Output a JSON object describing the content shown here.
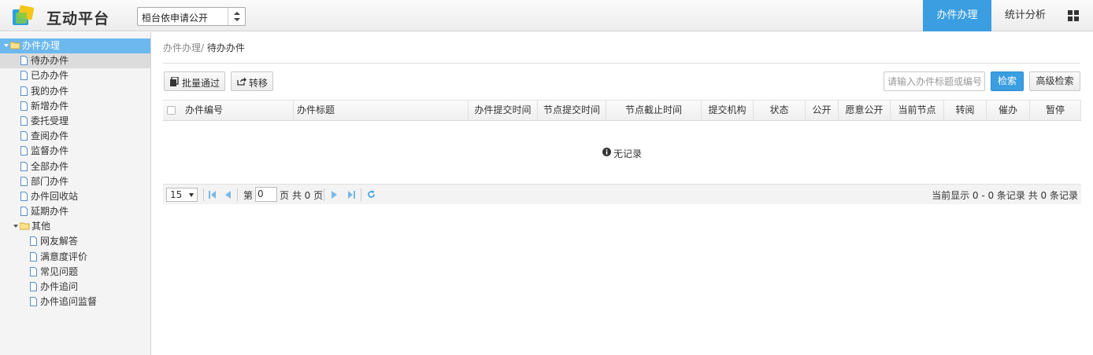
{
  "header": {
    "app_title": "互动平台",
    "platform_select": "桓台依申请公开",
    "tabs": [
      {
        "label": "办件办理",
        "active": true
      },
      {
        "label": "统计分析",
        "active": false
      }
    ],
    "accent_color": "#3a9ee0"
  },
  "sidebar": {
    "root": {
      "label": "办件办理",
      "icon": "folder-open-icon"
    },
    "items": [
      {
        "label": "待办办件",
        "selected": true
      },
      {
        "label": "已办办件"
      },
      {
        "label": "我的办件"
      },
      {
        "label": "新增办件"
      },
      {
        "label": "委托受理"
      },
      {
        "label": "查阅办件"
      },
      {
        "label": "监督办件"
      },
      {
        "label": "全部办件"
      },
      {
        "label": "部门办件"
      },
      {
        "label": "办件回收站"
      },
      {
        "label": "延期办件"
      }
    ],
    "other": {
      "label": "其他",
      "icon": "folder-icon"
    },
    "other_items": [
      {
        "label": "网友解答"
      },
      {
        "label": "满意度评价"
      },
      {
        "label": "常见问题"
      },
      {
        "label": "办件追问"
      },
      {
        "label": "办件追问监督"
      }
    ]
  },
  "breadcrumb": {
    "parent": "办件办理/ ",
    "current": "待办办件"
  },
  "toolbar": {
    "batch_pass": "批量通过",
    "transfer": "转移",
    "search_placeholder": "请输入办件标题或编号",
    "search_btn": "检索",
    "advanced_search": "高级检索"
  },
  "table": {
    "columns": [
      "办件编号",
      "办件标题",
      "办件提交时间",
      "节点提交时间",
      "节点截止时间",
      "提交机构",
      "状态",
      "公开",
      "愿意公开",
      "当前节点",
      "转阅",
      "催办",
      "暂停"
    ],
    "rows": [],
    "empty_text": "无记录"
  },
  "pager": {
    "page_size": "15",
    "page_prefix": "第",
    "page_value": "0",
    "page_suffix": "页 共 0 页",
    "info": "当前显示 0 - 0 条记录 共 0 条记录"
  }
}
